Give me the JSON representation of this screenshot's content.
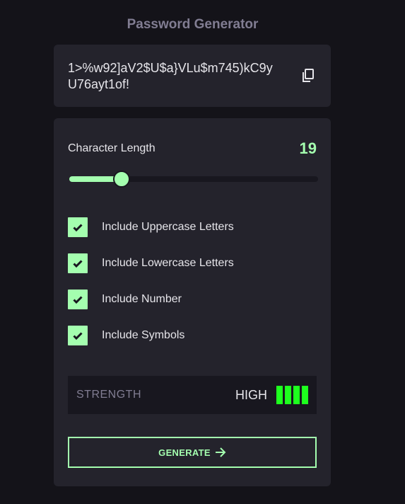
{
  "app": {
    "title": "Password Generator"
  },
  "password": {
    "value": "1>%w92]aV2$U$a}VLu$m745)kC9yU76ayt1of!"
  },
  "length": {
    "label": "Character Length",
    "value": "19",
    "fraction": 0.21
  },
  "options": [
    {
      "label": "Include Uppercase Letters",
      "checked": true
    },
    {
      "label": "Include Lowercase Letters",
      "checked": true
    },
    {
      "label": "Include Number",
      "checked": true
    },
    {
      "label": "Include Symbols",
      "checked": true
    }
  ],
  "strength": {
    "label": "STRENGTH",
    "value": "HIGH",
    "bars_filled": 4,
    "bars_total": 4
  },
  "generate": {
    "label": "GENERATE"
  },
  "colors": {
    "accent": "#A4FFAF",
    "strength_high": "#1EFF1E",
    "card": "#24232C",
    "background": "#141319"
  },
  "icons": {
    "copy": "copy-icon",
    "check": "check-icon",
    "arrow": "arrow-right-icon"
  }
}
